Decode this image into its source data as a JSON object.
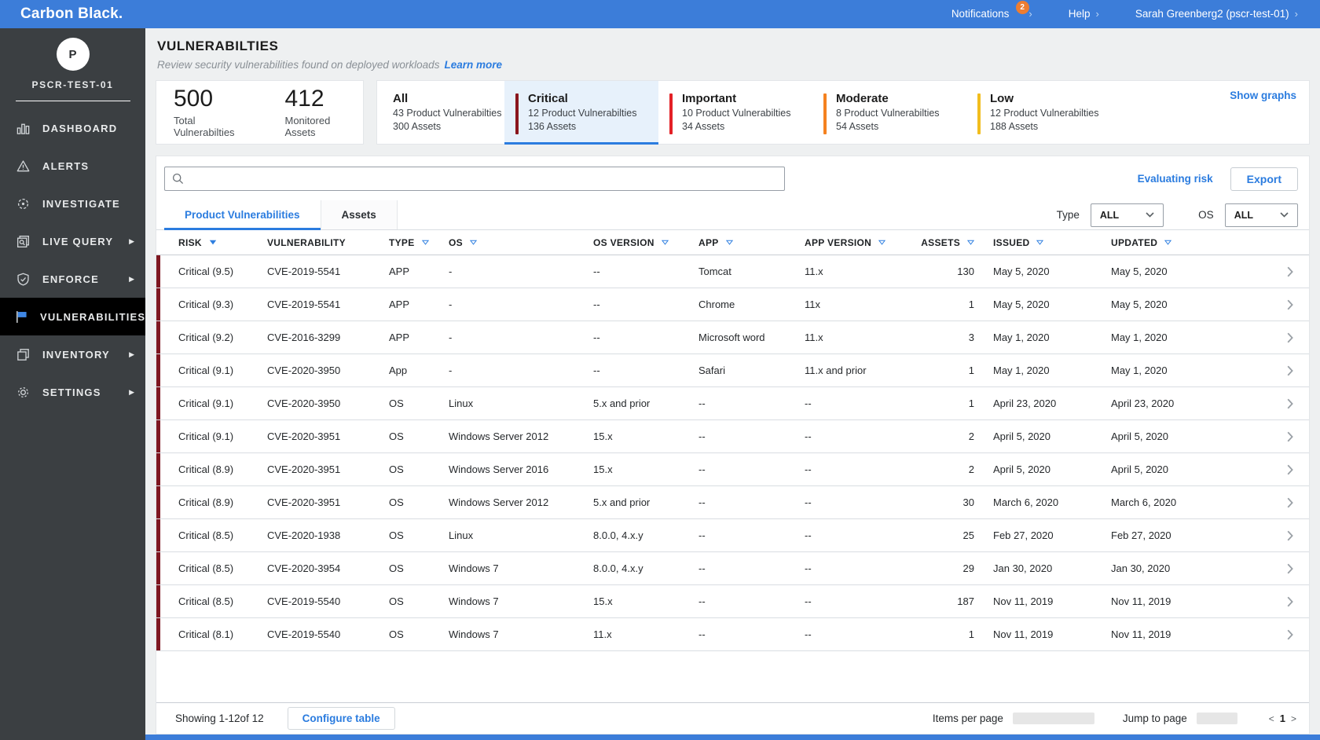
{
  "colors": {
    "topnav": "#3c7dd9",
    "link": "#2b7cdf",
    "badge": "#ed7d31",
    "critical": "#8a161d",
    "important": "#e32126",
    "moderate": "#f58220",
    "low": "#f2bd1e",
    "row_accent": "#7f1721"
  },
  "topnav": {
    "brand": "Carbon Black.",
    "notifications_label": "Notifications",
    "notifications_count": "2",
    "help_label": "Help",
    "user_label": "Sarah Greenberg2 (pscr-test-01)"
  },
  "sidebar": {
    "org_initial": "P",
    "org_name": "PSCR-TEST-01",
    "items": [
      {
        "label": "DASHBOARD",
        "icon": "bar-chart-icon",
        "expandable": false,
        "active": false
      },
      {
        "label": "ALERTS",
        "icon": "warning-triangle-icon",
        "expandable": false,
        "active": false
      },
      {
        "label": "INVESTIGATE",
        "icon": "target-icon",
        "expandable": false,
        "active": false
      },
      {
        "label": "LIVE QUERY",
        "icon": "query-search-icon",
        "expandable": true,
        "active": false
      },
      {
        "label": "ENFORCE",
        "icon": "shield-check-icon",
        "expandable": true,
        "active": false
      },
      {
        "label": "VULNERABILITIES",
        "icon": "flag-icon",
        "expandable": false,
        "active": true
      },
      {
        "label": "INVENTORY",
        "icon": "boxes-icon",
        "expandable": true,
        "active": false
      },
      {
        "label": "SETTINGS",
        "icon": "gear-icon",
        "expandable": true,
        "active": false
      }
    ]
  },
  "header": {
    "title": "VULNERABILTIES",
    "subtitle": "Review security vulnerabilities found on deployed workloads",
    "learn_more": "Learn more"
  },
  "summary": {
    "totals": [
      {
        "value": "500",
        "label": "Total Vulnerabilties"
      },
      {
        "value": "412",
        "label": "Monitored Assets"
      }
    ],
    "show_graphs": "Show graphs",
    "severity_tabs": [
      {
        "label": "All",
        "line1": "43  Product Vulnerabilties",
        "line2": "300 Assets",
        "color": "",
        "selected": false
      },
      {
        "label": "Critical",
        "line1": "12 Product Vulnerabilties",
        "line2": "136 Assets",
        "color": "#8a161d",
        "selected": true
      },
      {
        "label": "Important",
        "line1": "10 Product Vulnerabilties",
        "line2": "34 Assets",
        "color": "#e32126",
        "selected": false
      },
      {
        "label": "Moderate",
        "line1": "8 Product Vulnerabilties",
        "line2": "54 Assets",
        "color": "#f58220",
        "selected": false
      },
      {
        "label": "Low",
        "line1": "12 Product Vulnerabilties",
        "line2": "188 Assets",
        "color": "#f2bd1e",
        "selected": false
      }
    ]
  },
  "toolbar": {
    "search_placeholder": "",
    "evaluating_risk": "Evaluating risk",
    "export_label": "Export"
  },
  "view_tabs": [
    {
      "label": "Product Vulnerabilities",
      "active": true
    },
    {
      "label": "Assets",
      "active": false
    }
  ],
  "filters": {
    "type_label": "Type",
    "type_value": "ALL",
    "os_label": "OS",
    "os_value": "ALL"
  },
  "table": {
    "columns": [
      "RISK",
      "VULNERABILITY",
      "TYPE",
      "OS",
      "OS VERSION",
      "APP",
      "APP VERSION",
      "ASSETS",
      "ISSUED",
      "UPDATED"
    ],
    "sort": {
      "sorted_column": "RISK"
    },
    "rows": [
      [
        "Critical (9.5)",
        "CVE-2019-5541",
        "APP",
        "-",
        "--",
        "Tomcat",
        "11.x",
        "130",
        "May 5, 2020",
        "May 5, 2020"
      ],
      [
        "Critical (9.3)",
        "CVE-2019-5541",
        "APP",
        "-",
        "--",
        "Chrome",
        "11x",
        "1",
        "May 5, 2020",
        "May 5, 2020"
      ],
      [
        "Critical (9.2)",
        "CVE-2016-3299",
        "APP",
        "-",
        "--",
        "Microsoft word",
        "11.x",
        "3",
        "May 1, 2020",
        "May 1, 2020"
      ],
      [
        "Critical (9.1)",
        "CVE-2020-3950",
        "App",
        "-",
        "--",
        "Safari",
        "11.x and prior",
        "1",
        "May 1, 2020",
        "May 1, 2020"
      ],
      [
        "Critical (9.1)",
        "CVE-2020-3950",
        "OS",
        "Linux",
        "5.x and prior",
        "--",
        "--",
        "1",
        "April 23, 2020",
        "April 23, 2020"
      ],
      [
        "Critical (9.1)",
        "CVE-2020-3951",
        "OS",
        "Windows Server 2012",
        "15.x",
        "--",
        "--",
        "2",
        "April 5, 2020",
        "April 5, 2020"
      ],
      [
        "Critical (8.9)",
        "CVE-2020-3951",
        "OS",
        "Windows Server 2016",
        "15.x",
        "--",
        "--",
        "2",
        "April 5, 2020",
        "April 5, 2020"
      ],
      [
        "Critical (8.9)",
        "CVE-2020-3951",
        "OS",
        "Windows Server 2012",
        "5.x and prior",
        "--",
        "--",
        "30",
        "March 6, 2020",
        "March 6, 2020"
      ],
      [
        "Critical (8.5)",
        "CVE-2020-1938",
        "OS",
        "Linux",
        "8.0.0, 4.x.y",
        "--",
        "--",
        "25",
        "Feb 27, 2020",
        "Feb 27, 2020"
      ],
      [
        "Critical (8.5)",
        "CVE-2020-3954",
        "OS",
        "Windows 7",
        "8.0.0, 4.x.y",
        "--",
        "--",
        "29",
        "Jan 30, 2020",
        "Jan 30, 2020"
      ],
      [
        "Critical (8.5)",
        "CVE-2019-5540",
        "OS",
        "Windows 7",
        "15.x",
        "--",
        "--",
        "187",
        "Nov 11, 2019",
        "Nov 11, 2019"
      ],
      [
        "Critical (8.1)",
        "CVE-2019-5540",
        "OS",
        "Windows 7",
        "11.x",
        "--",
        "--",
        "1",
        "Nov 11, 2019",
        "Nov 11, 2019"
      ]
    ]
  },
  "footer": {
    "showing": "Showing 1-12of 12",
    "configure_table": "Configure table",
    "items_per_page": "Items per page",
    "jump_to_page": "Jump to page",
    "prev": "<",
    "page": "1",
    "next": ">"
  }
}
